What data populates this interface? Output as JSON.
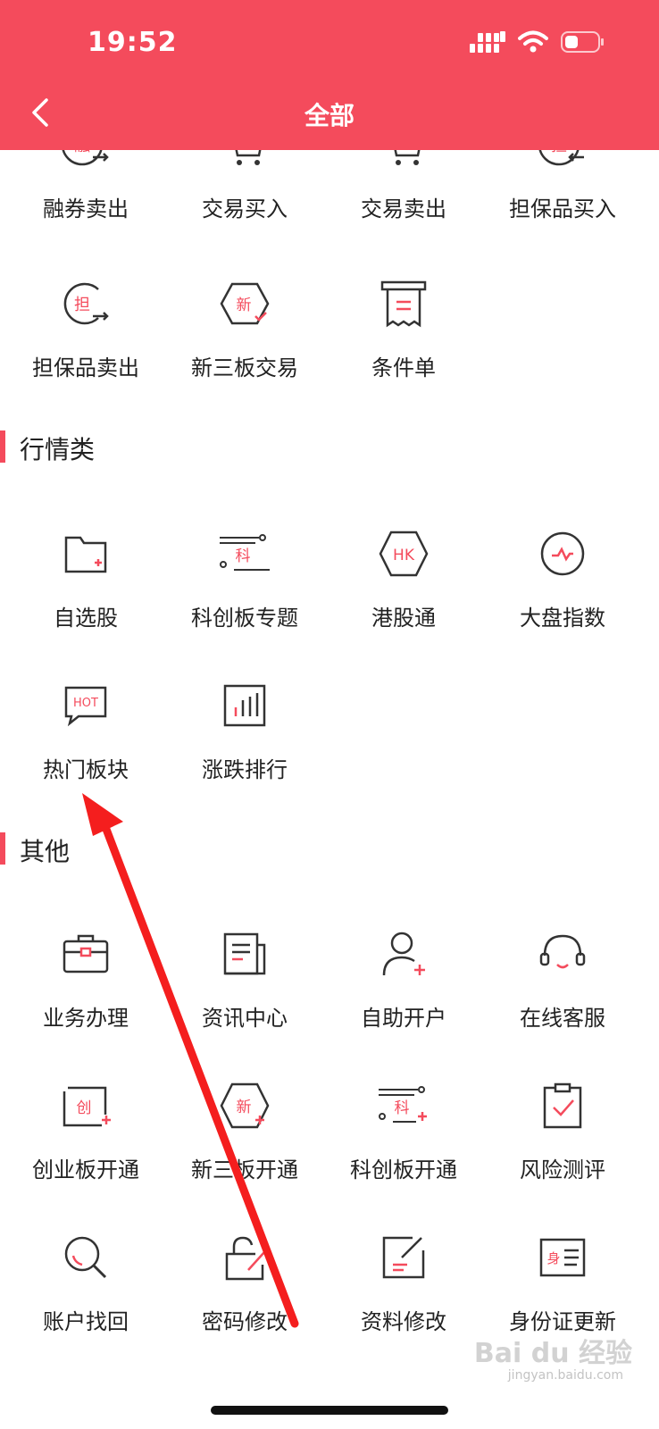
{
  "status_bar": {
    "time": "19:52"
  },
  "header": {
    "title": "全部"
  },
  "trade_row1": [
    "融券卖出",
    "交易买入",
    "交易卖出",
    "担保品买入"
  ],
  "trade_row2": [
    "担保品卖出",
    "新三板交易",
    "条件单"
  ],
  "section_market": {
    "title": "行情类",
    "row1": [
      "自选股",
      "科创板专题",
      "港股通",
      "大盘指数"
    ],
    "row2": [
      "热门板块",
      "涨跌排行"
    ]
  },
  "section_other": {
    "title": "其他",
    "row1": [
      "业务办理",
      "资讯中心",
      "自助开户",
      "在线客服"
    ],
    "row2": [
      "创业板开通",
      "新三板开通",
      "科创板开通",
      "风险测评"
    ],
    "row3": [
      "账户找回",
      "密码修改",
      "资料修改",
      "身份证更新"
    ]
  },
  "icon_text": {
    "rong": "融",
    "dan": "担",
    "xin": "新",
    "ke": "科",
    "hk": "HK",
    "hot": "HOT",
    "chuang": "创",
    "shen": "身"
  },
  "watermark": {
    "brand": "Bai du 经验",
    "url": "jingyan.baidu.com"
  },
  "colors": {
    "header": "#f44b5c",
    "accent": "#f44b5c",
    "icon": "#333333"
  }
}
